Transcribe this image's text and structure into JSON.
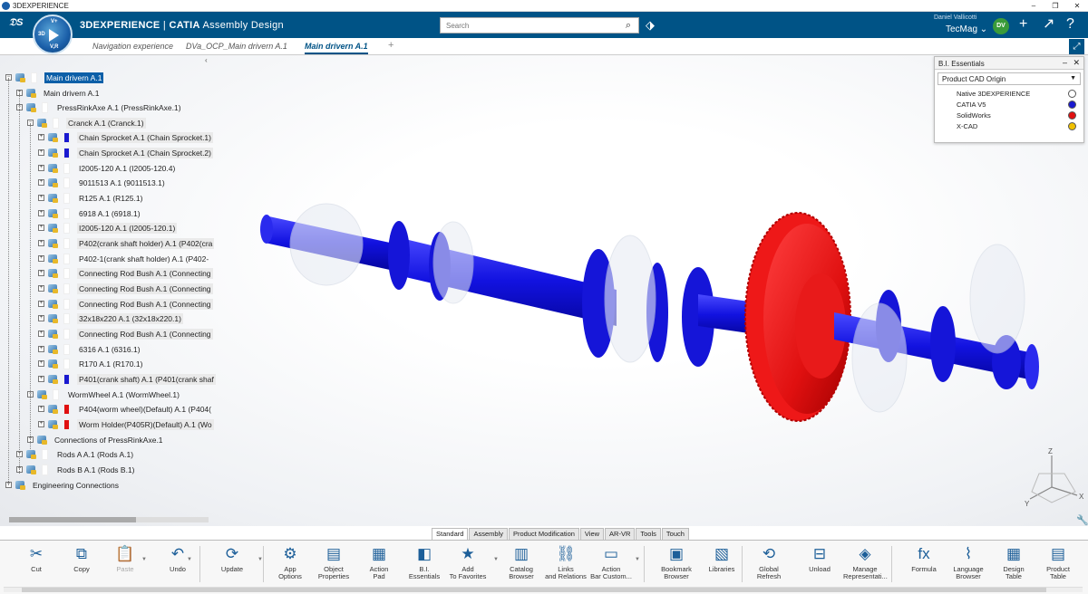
{
  "window": {
    "title": "3DEXPERIENCE",
    "min": "–",
    "max": "❐",
    "close": "✕"
  },
  "app": {
    "brand": "3DEXPERIENCE",
    "product": "CATIA",
    "module": "Assembly Design",
    "compass": {
      "top": "V+",
      "left": "3D",
      "bottom": "V,R"
    }
  },
  "search": {
    "placeholder": "Search"
  },
  "user": {
    "name": "Daniel Vallicotti",
    "tenant": "TecMag ⌄",
    "avatar": "DV"
  },
  "tabs": [
    {
      "label": "Navigation experience"
    },
    {
      "label": "DVa_OCP_Main drivern A.1"
    },
    {
      "label": "Main drivern A.1"
    }
  ],
  "tree": {
    "collapse": "‹",
    "rows": [
      {
        "label": "Main drivern A.1",
        "color": "#ffffff"
      },
      {
        "label": "Main drivern A.1",
        "color": "#ffffff"
      },
      {
        "label": "PressRinkAxe A.1 (PressRinkAxe.1)",
        "color": "#ffffff"
      },
      {
        "label": "Cranck A.1 (Cranck.1)",
        "color": "#ffffff"
      },
      {
        "label": "Chain Sprocket A.1 (Chain Sprocket.1)",
        "color": "#1a1ad0"
      },
      {
        "label": "Chain Sprocket A.1 (Chain Sprocket.2)",
        "color": "#1a1ad0"
      },
      {
        "label": "I2005-120 A.1 (I2005-120.4)",
        "color": "#ffffff"
      },
      {
        "label": "9011513 A.1 (9011513.1)",
        "color": "#ffffff"
      },
      {
        "label": "R125 A.1 (R125.1)",
        "color": "#ffffff"
      },
      {
        "label": "6918 A.1 (6918.1)",
        "color": "#ffffff"
      },
      {
        "label": "I2005-120 A.1 (I2005-120.1)",
        "color": "#ffffff"
      },
      {
        "label": "P402(crank shaft holder) A.1 (P402(cra",
        "color": "#ffffff"
      },
      {
        "label": "P402-1(crank shaft holder) A.1 (P402-",
        "color": "#ffffff"
      },
      {
        "label": "Connecting Rod Bush A.1 (Connecting",
        "color": "#ffffff"
      },
      {
        "label": "Connecting Rod Bush A.1 (Connecting",
        "color": "#ffffff"
      },
      {
        "label": "Connecting Rod Bush A.1 (Connecting",
        "color": "#ffffff"
      },
      {
        "label": "32x18x220 A.1 (32x18x220.1)",
        "color": "#ffffff"
      },
      {
        "label": "Connecting Rod Bush A.1 (Connecting",
        "color": "#ffffff"
      },
      {
        "label": "6316 A.1 (6316.1)",
        "color": "#ffffff"
      },
      {
        "label": "R170 A.1 (R170.1)",
        "color": "#ffffff"
      },
      {
        "label": "P401(crank shaft) A.1 (P401(crank shaf",
        "color": "#1a1ad0"
      },
      {
        "label": "WormWheel A.1 (WormWheel.1)",
        "color": "#ffffff"
      },
      {
        "label": "P404(worm wheel)(Default) A.1 (P404(",
        "color": "#e01010"
      },
      {
        "label": "Worm Holder(P405R)(Default) A.1 (Wo",
        "color": "#e01010"
      },
      {
        "label": "Connections of PressRinkAxe.1",
        "color": "#ffffff"
      },
      {
        "label": "Rods A A.1 (Rods A.1)",
        "color": "#ffffff"
      },
      {
        "label": "Rods B A.1 (Rods B.1)",
        "color": "#ffffff"
      },
      {
        "label": "Engineering Connections",
        "color": "#ffffff"
      }
    ]
  },
  "bi_panel": {
    "title": "B.I. Essentials",
    "minimize": "–",
    "close": "✕",
    "dropdown": "Product CAD Origin",
    "legend": [
      {
        "label": "Native 3DEXPERIENCE",
        "color": "#ffffff"
      },
      {
        "label": "CATIA V5",
        "color": "#1a1ad0"
      },
      {
        "label": "SolidWorks",
        "color": "#e01010"
      },
      {
        "label": "X-CAD",
        "color": "#f0c000"
      }
    ]
  },
  "axis": {
    "z": "Z",
    "x": "X",
    "y": "Y"
  },
  "bottom_tabs": [
    "Standard",
    "Assembly",
    "Product Modification",
    "View",
    "AR-VR",
    "Tools",
    "Touch"
  ],
  "toolbar": [
    {
      "label": "Cut",
      "icon": "scissors-icon",
      "glyph": "✂"
    },
    {
      "label": "Copy",
      "icon": "copy-icon",
      "glyph": "⧉"
    },
    {
      "label": "Paste",
      "icon": "paste-icon",
      "glyph": "📋"
    },
    {
      "label": "Undo",
      "icon": "undo-icon",
      "glyph": "↶"
    },
    {
      "label": "Update",
      "icon": "update-icon",
      "glyph": "⟳"
    },
    {
      "label": "App\nOptions",
      "icon": "app-options-icon",
      "glyph": "⚙"
    },
    {
      "label": "Object\nProperties",
      "icon": "properties-icon",
      "glyph": "▤"
    },
    {
      "label": "Action\nPad",
      "icon": "action-pad-icon",
      "glyph": "▦"
    },
    {
      "label": "B.I.\nEssentials",
      "icon": "bi-essentials-icon",
      "glyph": "◧"
    },
    {
      "label": "Add\nTo Favorites",
      "icon": "favorites-icon",
      "glyph": "★"
    },
    {
      "label": "Catalog\nBrowser",
      "icon": "catalog-icon",
      "glyph": "▥"
    },
    {
      "label": "Links\nand Relations",
      "icon": "links-icon",
      "glyph": "⛓"
    },
    {
      "label": "Action\nBar Custom...",
      "icon": "action-bar-icon",
      "glyph": "▭"
    },
    {
      "label": "Bookmark\nBrowser",
      "icon": "bookmark-icon",
      "glyph": "▣"
    },
    {
      "label": "Libraries",
      "icon": "libraries-icon",
      "glyph": "▧"
    },
    {
      "label": "Global\nRefresh",
      "icon": "refresh-icon",
      "glyph": "⟲"
    },
    {
      "label": "Unload",
      "icon": "unload-icon",
      "glyph": "⊟"
    },
    {
      "label": "Manage\nRepresentati...",
      "icon": "manage-representations-icon",
      "glyph": "◈"
    },
    {
      "label": "Formula",
      "icon": "formula-icon",
      "glyph": "fx"
    },
    {
      "label": "Language\nBrowser",
      "icon": "language-browser-icon",
      "glyph": "⌇"
    },
    {
      "label": "Design\nTable",
      "icon": "design-table-icon",
      "glyph": "▦"
    },
    {
      "label": "Product\nTable",
      "icon": "product-table-icon",
      "glyph": "▤"
    }
  ]
}
